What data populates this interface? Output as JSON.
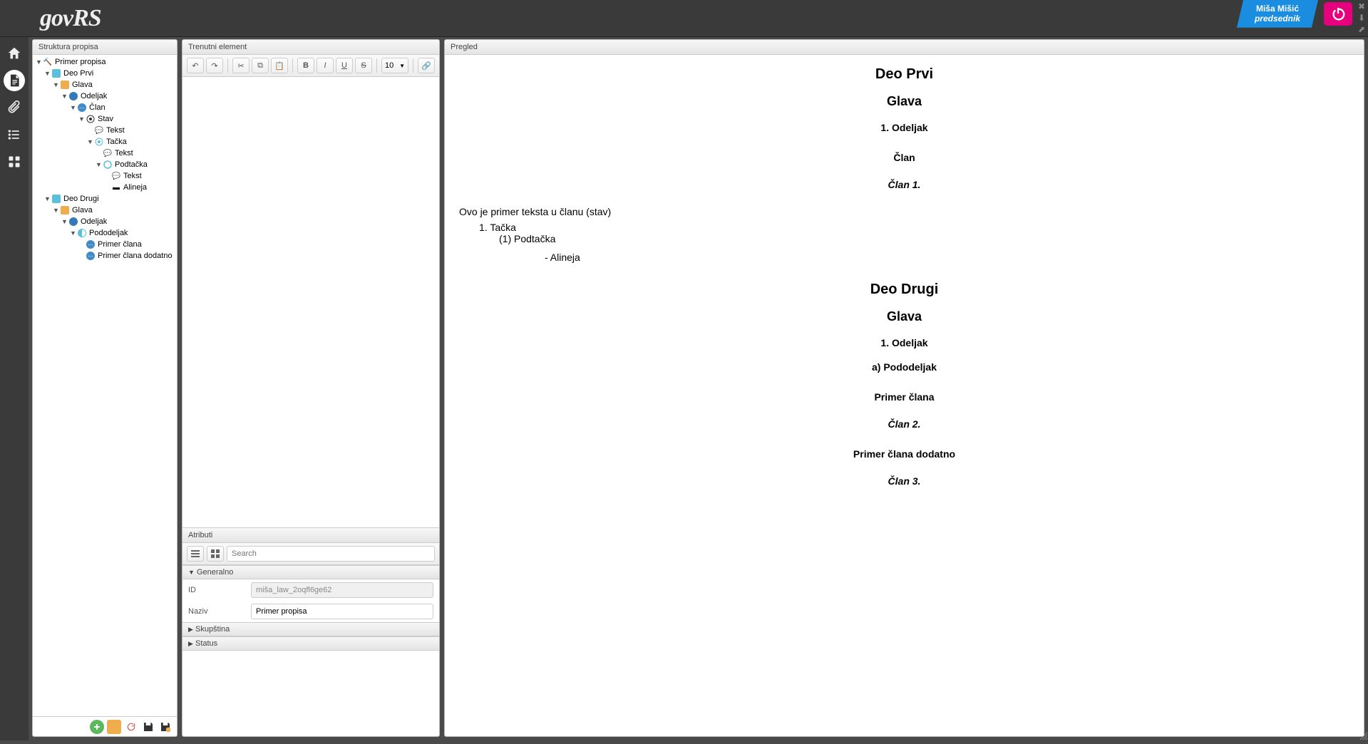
{
  "header": {
    "logo_text": "govRS",
    "user_name": "Miša Mišić",
    "user_role": "predsednik"
  },
  "panels": {
    "structure_title": "Struktura propisa",
    "editor_title": "Trenutni element",
    "preview_title": "Pregled",
    "attributes_title": "Atributi"
  },
  "tree": {
    "root": "Primer propisa",
    "deo1": "Deo Prvi",
    "glava": "Glava",
    "odeljak": "Odeljak",
    "clan": "Član",
    "stav": "Stav",
    "tekst": "Tekst",
    "tacka": "Tačka",
    "podtacka": "Podtačka",
    "alineja": "Alineja",
    "deo2": "Deo Drugi",
    "pododeljak": "Pododeljak",
    "primer_clana": "Primer člana",
    "primer_clana_dodatno": "Primer člana dodatno"
  },
  "editor": {
    "font_size": "10"
  },
  "attributes": {
    "search_placeholder": "Search",
    "group_general": "Generalno",
    "id_label": "ID",
    "id_value": "miša_law_2oqfl6ge62",
    "name_label": "Naziv",
    "name_value": "Primer propisa",
    "group_skupstina": "Skupština",
    "group_status": "Status"
  },
  "preview": {
    "deo_prvi": "Deo Prvi",
    "glava1": "Glava",
    "odeljak1": "1. Odeljak",
    "clan_label": "Član",
    "clan1": "Član 1.",
    "stav_text": "Ovo je primer teksta u članu (stav)",
    "tacka_item": "1.  Tačka",
    "podtacka_item": "(1) Podtačka",
    "alineja_item": "- Alineja",
    "deo_drugi": "Deo Drugi",
    "glava2": "Glava",
    "odeljak2": "1. Odeljak",
    "pododeljak": "a) Pododeljak",
    "primer_clana": "Primer člana",
    "clan2": "Član 2.",
    "primer_clana_dodatno": "Primer člana dodatno",
    "clan3": "Član 3."
  }
}
